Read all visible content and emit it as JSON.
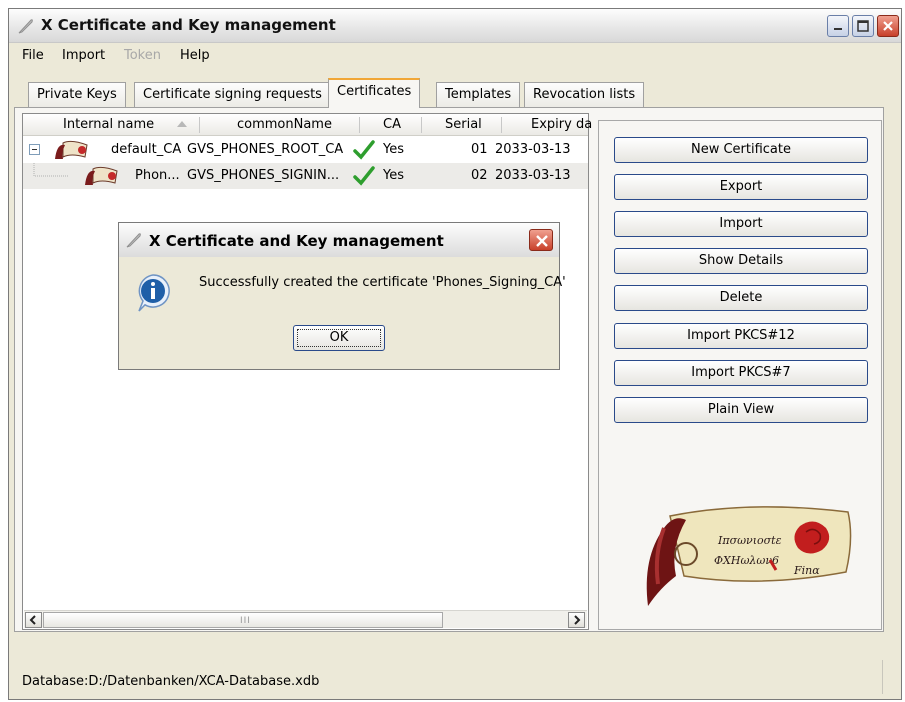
{
  "window": {
    "title": "X Certificate and Key management",
    "icon": "feather-pen-icon"
  },
  "menu": [
    "File",
    "Import",
    "Token",
    "Help"
  ],
  "menu_disabled": [
    "Token"
  ],
  "tabs": [
    "Private Keys",
    "Certificate signing requests",
    "Certificates",
    "Templates",
    "Revocation lists"
  ],
  "active_tab": "Certificates",
  "table": {
    "columns": [
      "Internal name",
      "commonName",
      "CA",
      "Serial",
      "Expiry da"
    ],
    "sorted_column": "Internal name",
    "rows": [
      {
        "internal_name": "default_CA",
        "common_name": "GVS_PHONES_ROOT_CA",
        "ca": "Yes",
        "serial": "01",
        "expiry": "2033-03-13",
        "tree": "collapse"
      },
      {
        "internal_name": "Phon...",
        "common_name": "GVS_PHONES_SIGNIN...",
        "ca": "Yes",
        "serial": "02",
        "expiry": "2033-03-13",
        "tree": "child",
        "selected": true
      }
    ]
  },
  "buttons": [
    "New Certificate",
    "Export",
    "Import",
    "Show Details",
    "Delete",
    "Import PKCS#12",
    "Import PKCS#7",
    "Plain View"
  ],
  "logo": {
    "line1": "Ιπσωνιοσtε",
    "line2": "ΦΧΗωλων6",
    "line3": "Finα"
  },
  "dialog": {
    "title": "X Certificate and Key management",
    "message": "Successfully created the certificate 'Phones_Signing_CA'",
    "ok_label": "OK",
    "icon": "info-icon"
  },
  "status": "Database:D:/Datenbanken/XCA-Database.xdb",
  "colors": {
    "active_tab_accent": "#f1a737",
    "checkmark": "#2e9e2e",
    "close_button": "#c8402a",
    "info_icon": "#1f5fa8"
  }
}
